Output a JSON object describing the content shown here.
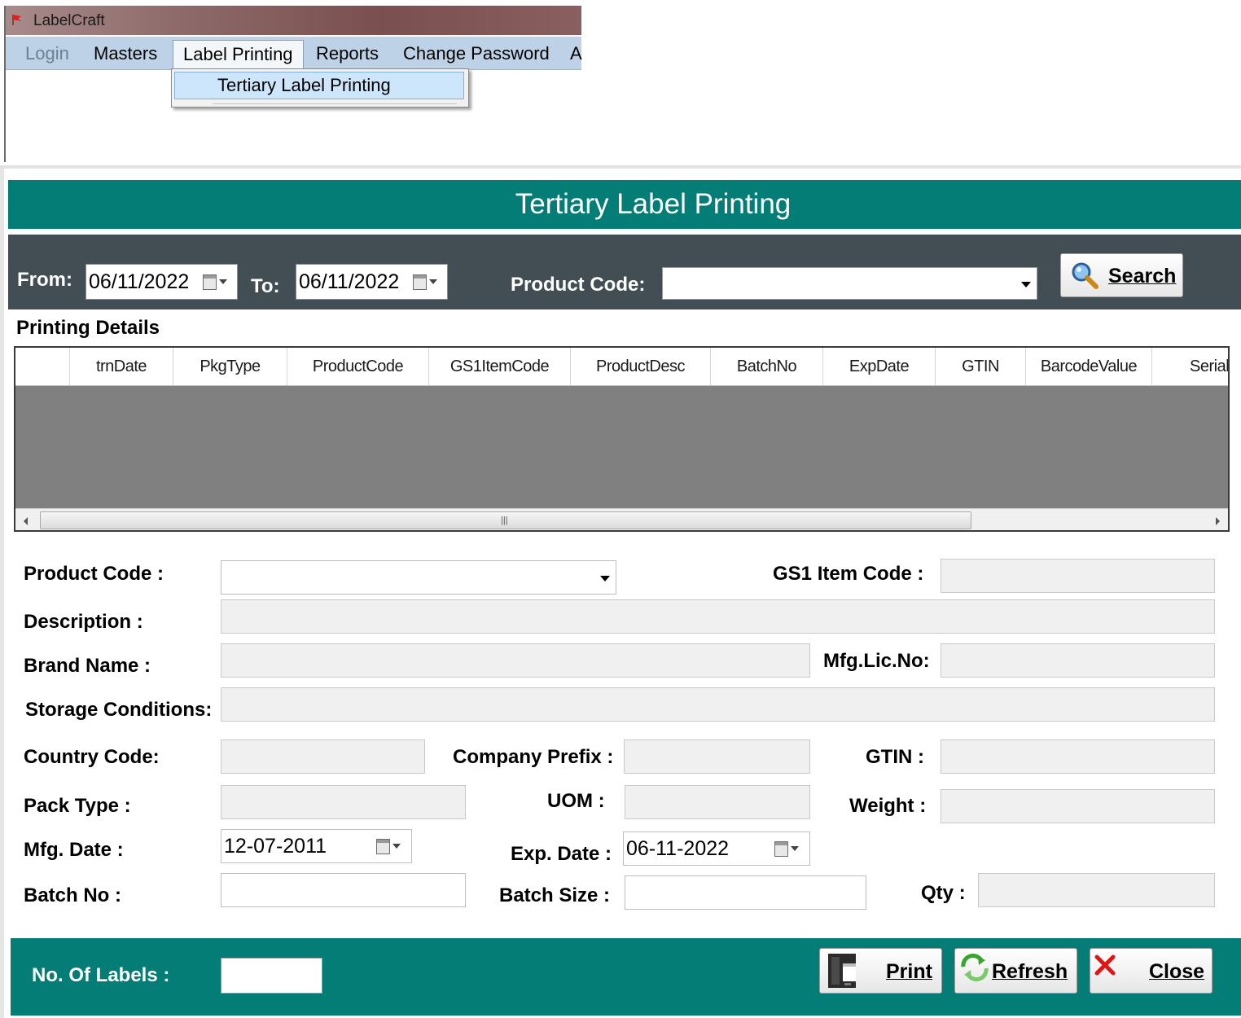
{
  "app": {
    "title": "LabelCraft",
    "menu": {
      "login": "Login",
      "masters": "Masters",
      "label_printing": "Label Printing",
      "reports": "Reports",
      "change_password": "Change Password",
      "truncated": "A"
    },
    "dropdown_item": "Tertiary Label Printing"
  },
  "form": {
    "header_title": "Tertiary Label Printing",
    "filter": {
      "from_label": "From:",
      "from_value": "06/11/2022",
      "to_label": "To:",
      "to_value": "06/11/2022",
      "product_code_label": "Product Code:",
      "product_code_value": "",
      "search_label": "Search"
    },
    "printing_details_label": "Printing Details",
    "grid_columns": [
      "trnDate",
      "PkgType",
      "ProductCode",
      "GS1ItemCode",
      "ProductDesc",
      "BatchNo",
      "ExpDate",
      "GTIN",
      "BarcodeValue",
      "SerialN"
    ],
    "fields": {
      "product_code_label": "Product Code :",
      "product_code_value": "",
      "gs1_item_code_label": "GS1 Item Code :",
      "gs1_item_code_value": "",
      "description_label": "Description :",
      "description_value": "",
      "brand_name_label": "Brand Name :",
      "brand_name_value": "",
      "mfg_lic_no_label": "Mfg.Lic.No:",
      "mfg_lic_no_value": "",
      "storage_conditions_label": "Storage Conditions:",
      "storage_conditions_value": "",
      "country_code_label": "Country Code:",
      "country_code_value": "",
      "company_prefix_label": "Company Prefix :",
      "company_prefix_value": "",
      "gtin_label": "GTIN :",
      "gtin_value": "",
      "pack_type_label": "Pack Type :",
      "pack_type_value": "",
      "uom_label": "UOM  :",
      "uom_value": "",
      "weight_label": "Weight :",
      "weight_value": "",
      "mfg_date_label": "Mfg. Date :",
      "mfg_date_value": "12-07-2011",
      "exp_date_label": "Exp. Date :",
      "exp_date_value": "06-11-2022",
      "batch_no_label": "Batch No :",
      "batch_no_value": "",
      "batch_size_label": "Batch Size :",
      "batch_size_value": "",
      "qty_label": "Qty :",
      "qty_value": ""
    },
    "footer": {
      "no_of_labels_label": "No. Of Labels :",
      "no_of_labels_value": "",
      "print_label": "Print",
      "refresh_label": "Refresh",
      "close_label": "Close"
    }
  },
  "colors": {
    "header_teal": "#047d77",
    "filter_bar": "#434e54",
    "grid_body": "#808080",
    "menubar": "#bdd2e6"
  },
  "icons": {
    "app_icon": "red-flag-icon",
    "search_icon": "magnifier-icon",
    "print_icon": "printer-icon",
    "refresh_icon": "refresh-arrows-icon",
    "close_icon": "red-x-icon",
    "calendar_icon": "calendar-dropdown-icon"
  }
}
